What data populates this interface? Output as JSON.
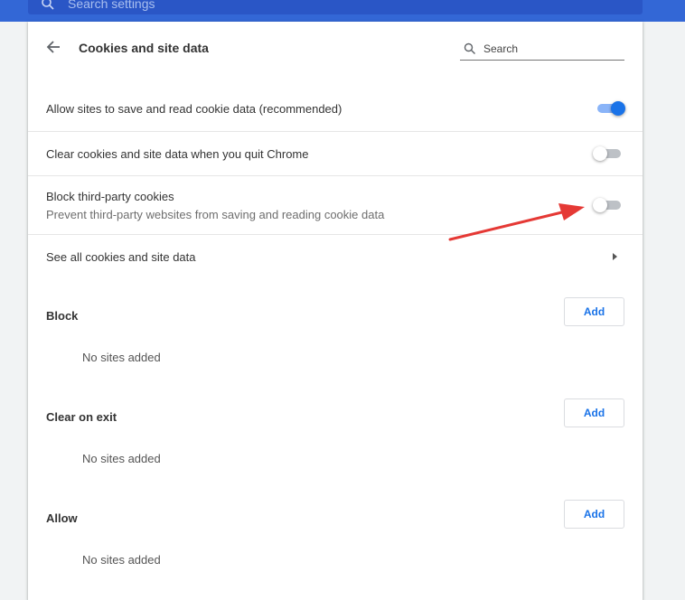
{
  "topbar": {
    "search_text": "Search settings"
  },
  "header": {
    "title": "Cookies and site data",
    "search_placeholder": "Search"
  },
  "settings": [
    {
      "label": "Allow sites to save and read cookie data (recommended)",
      "toggle": "on"
    },
    {
      "label": "Clear cookies and site data when you quit Chrome",
      "toggle": "off"
    },
    {
      "label": "Block third-party cookies",
      "sublabel": "Prevent third-party websites from saving and reading cookie data",
      "toggle": "off"
    },
    {
      "label": "See all cookies and site data"
    }
  ],
  "sections": [
    {
      "title": "Block",
      "button": "Add",
      "empty": "No sites added"
    },
    {
      "title": "Clear on exit",
      "button": "Add",
      "empty": "No sites added"
    },
    {
      "title": "Allow",
      "button": "Add",
      "empty": "No sites added"
    }
  ],
  "colors": {
    "accent": "#1a73e8",
    "topbar": "#3367d6",
    "annotation": "#e53935"
  },
  "icons": {
    "back": "arrow-left-icon",
    "search": "search-icon",
    "submenu": "caret-right-icon"
  }
}
